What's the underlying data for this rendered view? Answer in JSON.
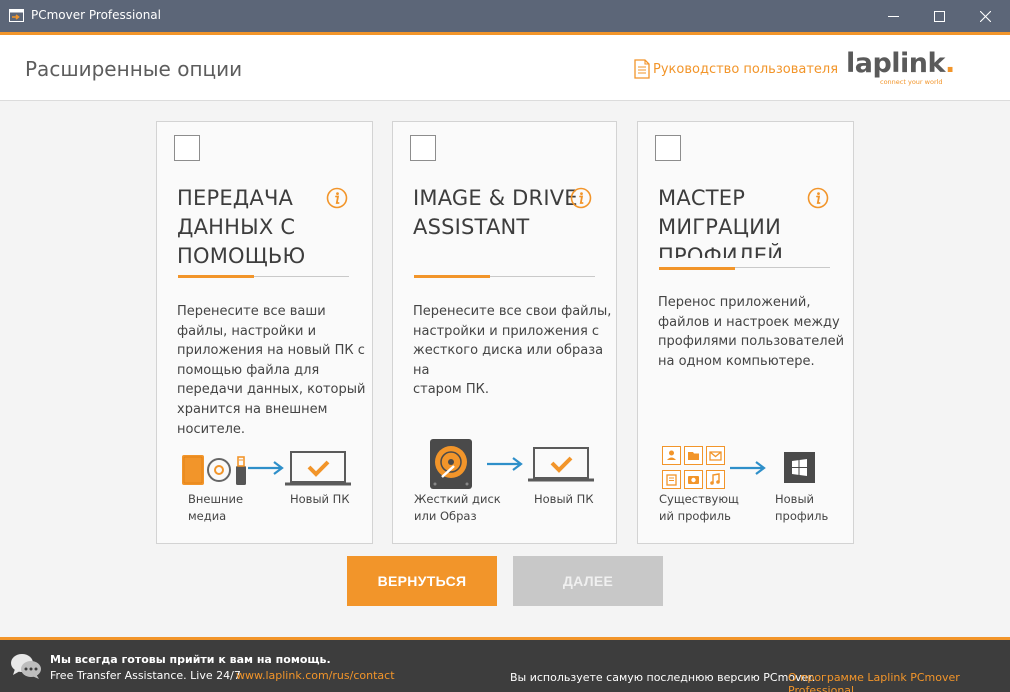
{
  "window": {
    "title": "PCmover Professional",
    "app_icon": "pcmover-icon",
    "controls": [
      "minimize-icon",
      "maximize-icon",
      "close-icon"
    ]
  },
  "header": {
    "title": "Расширенные опции",
    "guide_label": "Руководство пользователя",
    "guide_icon": "document-icon",
    "logo": {
      "brand": "laplink",
      "tagline": "connect your world"
    }
  },
  "cards": [
    {
      "heading": [
        "ПЕРЕДАЧА",
        "ДАННЫХ С",
        "ПОМОЩЬЮ"
      ],
      "description": [
        "Перенесите все ваши",
        "файлы, настройки и",
        "приложения на новый ПК с",
        "помощью файла для",
        "передачи данных, который",
        "хранится на внешнем",
        "носителе."
      ],
      "source_caption": [
        "Внешние",
        "медиа"
      ],
      "target_caption": "Новый ПК",
      "source_icon": "external-media-icon",
      "target_icon": "laptop-check-icon"
    },
    {
      "heading": [
        "IMAGE & DRIVE",
        "ASSISTANT"
      ],
      "description": [
        "Перенесите все свои файлы,",
        "настройки и приложения с",
        "жесткого диска или образа на",
        "старом ПК."
      ],
      "source_caption": [
        "Жесткий диск",
        "или Образ"
      ],
      "target_caption": "Новый ПК",
      "source_icon": "hard-drive-icon",
      "target_icon": "laptop-check-icon"
    },
    {
      "heading": [
        "МАСТЕР",
        "МИГРАЦИИ",
        "ПРОФИЛЕЙ"
      ],
      "description": [
        "Перенос приложений,",
        "файлов и настроек между",
        "профилями пользователей",
        "на одном компьютере."
      ],
      "source_caption": [
        "Существующ",
        "ий профиль"
      ],
      "target_caption": [
        "Новый",
        "профиль"
      ],
      "source_icon": "profile-grid-icon",
      "target_icon": "windows-icon"
    }
  ],
  "buttons": {
    "back": "ВЕРНУТЬСЯ",
    "next": "ДАЛЕЕ",
    "next_enabled": false
  },
  "footer": {
    "help_title": "Мы всегда готовы прийти к вам на помощь.",
    "help_sub": "Free Transfer Assistance. Live 24/7.",
    "help_link": "www.laplink.com/rus/contact",
    "status": "Вы используете самую последнюю версию PCmover.",
    "about": "О программе Laplink PCmover Professional"
  },
  "colors": {
    "accent": "#f2952a",
    "titlebar": "#5c6678",
    "footer": "#3d3d3d",
    "arrow": "#2e8fc9",
    "disabled": "#c8c8c8"
  }
}
